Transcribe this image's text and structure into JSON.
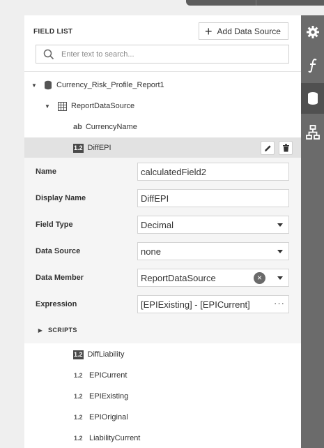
{
  "field_list": {
    "title": "FIELD LIST",
    "add_data_source_label": "Add Data Source",
    "search_placeholder": "Enter text to search..."
  },
  "tree": {
    "report": "Currency_Risk_Profile_Report1",
    "data_source": "ReportDataSource",
    "fields_above": [
      {
        "tag": "ab",
        "name": "CurrencyName"
      }
    ],
    "selected_field": {
      "tag": "1.2",
      "name": "DiffEPI"
    },
    "fields_below": [
      {
        "tag": "1.2",
        "name": "DiffLiability",
        "boxed": true
      },
      {
        "tag": "1.2",
        "name": "EPICurrent",
        "boxed": false
      },
      {
        "tag": "1.2",
        "name": "EPIExisting",
        "boxed": false
      },
      {
        "tag": "1.2",
        "name": "EPIOriginal",
        "boxed": false
      },
      {
        "tag": "1.2",
        "name": "LiabilityCurrent",
        "boxed": false
      }
    ]
  },
  "properties": {
    "name_label": "Name",
    "name_value": "calculatedField2",
    "display_name_label": "Display Name",
    "display_name_value": "DiffEPI",
    "field_type_label": "Field Type",
    "field_type_value": "Decimal",
    "data_source_label": "Data Source",
    "data_source_value": "none",
    "data_member_label": "Data Member",
    "data_member_value": "ReportDataSource",
    "expression_label": "Expression",
    "expression_value": "[EPIExisting] - [EPICurrent]",
    "scripts_label": "SCRIPTS"
  },
  "rail_icons": [
    "gear-icon",
    "function-icon",
    "database-icon",
    "hierarchy-icon"
  ]
}
